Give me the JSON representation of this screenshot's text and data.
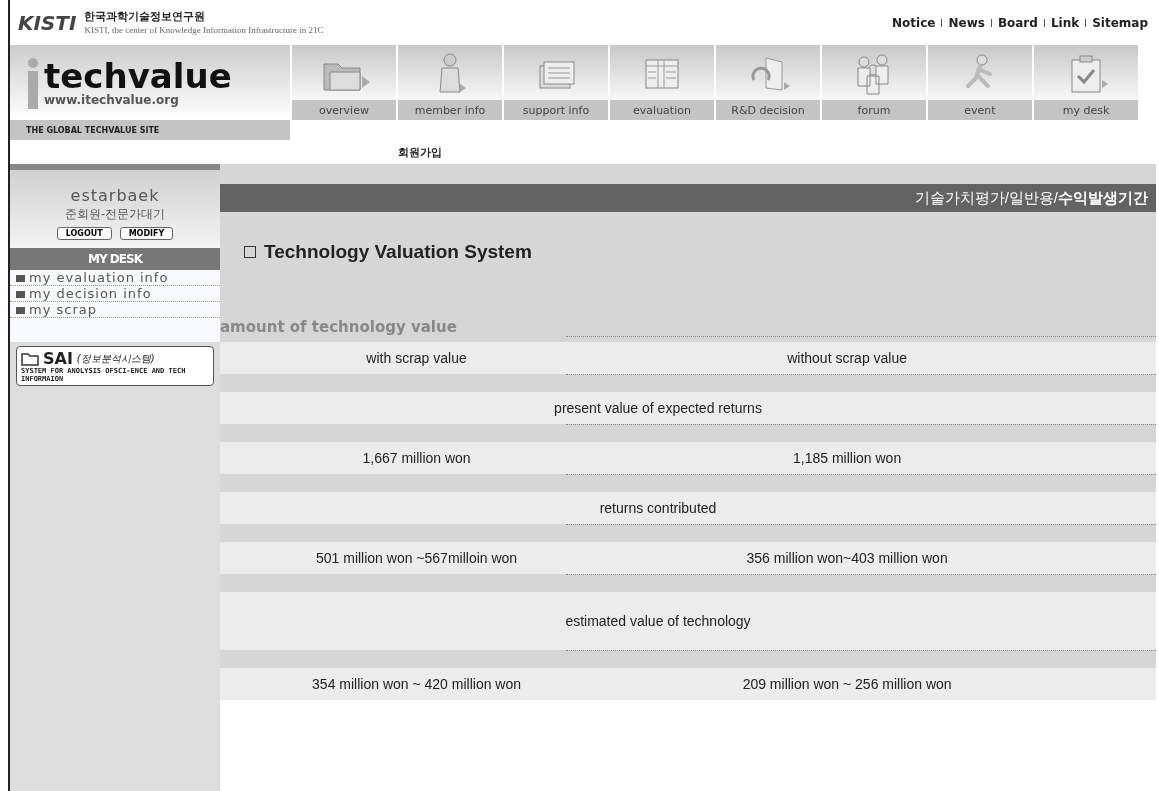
{
  "header": {
    "org_name": "한국과학기술정보연구원",
    "org_tagline": "KISTI, the center of Knowledge Information Infrastructure in 21C",
    "logo": "KISTI",
    "top_links": [
      "Notice",
      "News",
      "Board",
      "Link",
      "Sitemap"
    ]
  },
  "site": {
    "name": "techvalue",
    "url": "www.itechvalue.org",
    "slogan": "THE GLOBAL TECHVALUE SITE"
  },
  "nav": [
    {
      "label": "overview",
      "kind": "folder"
    },
    {
      "label": "member info",
      "kind": "person"
    },
    {
      "label": "support info",
      "kind": "stack"
    },
    {
      "label": "evaluation",
      "kind": "sheet"
    },
    {
      "label": "R&D decision",
      "kind": "cycle"
    },
    {
      "label": "forum",
      "kind": "group"
    },
    {
      "label": "event",
      "kind": "runner"
    },
    {
      "label": "my desk",
      "kind": "clipboard"
    }
  ],
  "subnav": "회원가입",
  "sidebar": {
    "user": "estarbaek",
    "level": "준회원-전문가대기",
    "buttons": [
      "LOGOUT",
      "MODIFY"
    ],
    "section": "MY DESK",
    "items": [
      "my evaluation info",
      "my decision info",
      "my scrap"
    ],
    "sai": {
      "name": "SAI",
      "korean": "(정보분석시스템)",
      "desc": "SYSTEM FOR ANOLYSIS OFSCI-ENCE AND TECH INFORMAION"
    }
  },
  "breadcrumb": "기술가치평가/일반용/**수익발생기간**",
  "title": "Technology Valuation System",
  "section": "amount of technology value",
  "rows": [
    {
      "kind": "pair",
      "cells": [
        "with scrap value",
        "without scrap value"
      ]
    },
    {
      "kind": "single",
      "cells": [
        "present value of expected returns"
      ]
    },
    {
      "kind": "pair",
      "cells": [
        "1,667 million won",
        "1,185 million won"
      ]
    },
    {
      "kind": "single",
      "cells": [
        "returns contributed"
      ]
    },
    {
      "kind": "pair",
      "cells": [
        "501 million won ~567milloin won",
        "356 million won~403 million won"
      ]
    },
    {
      "kind": "tall",
      "cells": [
        "estimated value of technology"
      ]
    },
    {
      "kind": "pair",
      "cells": [
        "354 million won ~ 420 million won",
        "209 million won ~ 256 million won"
      ]
    }
  ]
}
